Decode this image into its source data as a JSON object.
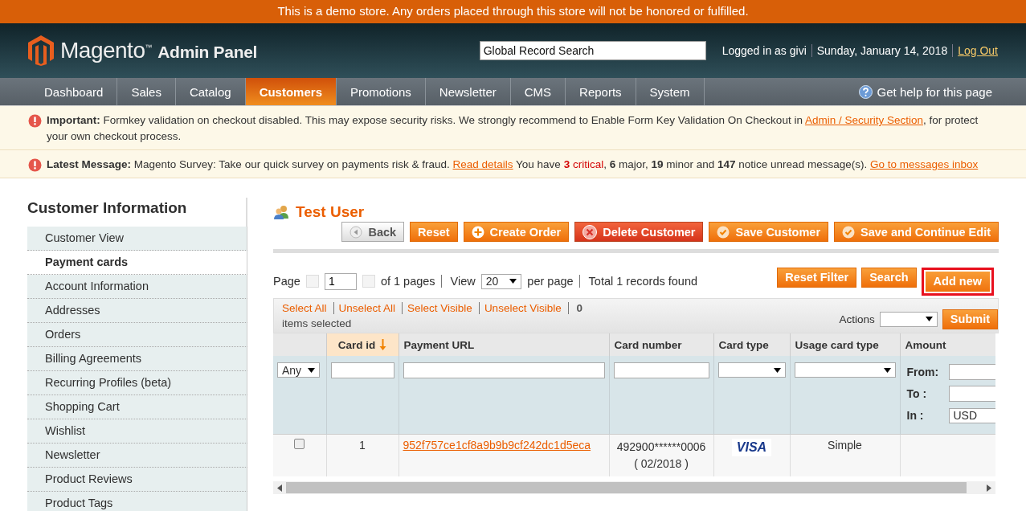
{
  "demo_notice": "This is a demo store. Any orders placed through this store will not be honored or fulfilled.",
  "header": {
    "logo": {
      "name": "Magento",
      "mark": "™",
      "suffix": "Admin Panel"
    },
    "search": {
      "placeholder": "Global Record Search"
    },
    "user": "Logged in as givi",
    "date": "Sunday, January 14, 2018",
    "logout": "Log Out"
  },
  "nav": {
    "tabs": [
      {
        "label": "Dashboard",
        "selected": false
      },
      {
        "label": "Sales",
        "selected": false
      },
      {
        "label": "Catalog",
        "selected": false
      },
      {
        "label": "Customers",
        "selected": true
      },
      {
        "label": "Promotions",
        "selected": false
      },
      {
        "label": "Newsletter",
        "selected": false
      },
      {
        "label": "CMS",
        "selected": false
      },
      {
        "label": "Reports",
        "selected": false
      },
      {
        "label": "System",
        "selected": false
      }
    ],
    "help": "Get help for this page"
  },
  "messages": [
    {
      "parts": [
        {
          "kind": "label",
          "text": "Important:"
        },
        {
          "kind": "text",
          "text": " Formkey validation on checkout disabled. This may expose security risks. We strongly recommend to Enable Form Key Validation On Checkout in "
        },
        {
          "kind": "link",
          "text": "Admin / Security Section"
        },
        {
          "kind": "text",
          "text": ", for protect your own checkout process."
        }
      ]
    },
    {
      "parts": [
        {
          "kind": "label",
          "text": "Latest Message:"
        },
        {
          "kind": "text",
          "text": " Magento Survey: Take our quick survey on payments risk & fraud. "
        },
        {
          "kind": "link",
          "text": "Read details"
        },
        {
          "kind": "text",
          "text": " You have "
        },
        {
          "kind": "critical",
          "text": "**3** critical"
        },
        {
          "kind": "text",
          "text": ", **6** major, **19** minor and **147** notice unread message(s). "
        },
        {
          "kind": "link",
          "text": "Go to messages inbox"
        }
      ]
    }
  ],
  "sidebar": {
    "title": "Customer Information",
    "items": [
      {
        "label": "Customer View",
        "selected": false
      },
      {
        "label": "Payment cards",
        "selected": true
      },
      {
        "label": "Account Information",
        "selected": false
      },
      {
        "label": "Addresses",
        "selected": false
      },
      {
        "label": "Orders",
        "selected": false
      },
      {
        "label": "Billing Agreements",
        "selected": false
      },
      {
        "label": "Recurring Profiles (beta)",
        "selected": false
      },
      {
        "label": "Shopping Cart",
        "selected": false
      },
      {
        "label": "Wishlist",
        "selected": false
      },
      {
        "label": "Newsletter",
        "selected": false
      },
      {
        "label": "Product Reviews",
        "selected": false
      },
      {
        "label": "Product Tags",
        "selected": false
      }
    ]
  },
  "page_title": "Test User",
  "buttons": [
    {
      "label": "Back",
      "kind": "back"
    },
    {
      "label": "Reset",
      "kind": "plain"
    },
    {
      "label": "Create Order",
      "kind": "add"
    },
    {
      "label": "Delete Customer",
      "kind": "delete"
    },
    {
      "label": "Save Customer",
      "kind": "save"
    },
    {
      "label": "Save and Continue Edit",
      "kind": "save"
    }
  ],
  "pager": {
    "page_label": "Page",
    "page": "1",
    "of_pages": "of 1 pages",
    "view_label": "View",
    "per_page": "20",
    "per_page_label": "per page",
    "total": "Total 1 records found"
  },
  "grid_buttons": [
    {
      "label": "Reset Filter",
      "highlighted": false
    },
    {
      "label": "Search",
      "highlighted": false
    },
    {
      "label": "Add new",
      "highlighted": true
    }
  ],
  "massaction": {
    "links": [
      "Select All",
      "Unselect All",
      "Select Visible",
      "Unselect Visible"
    ],
    "count": "0",
    "selected_label": "items selected",
    "actions_label": "Actions",
    "submit": "Submit"
  },
  "table": {
    "columns": [
      {
        "sorted": false
      },
      {
        "label": "Card id",
        "sorted": true
      },
      {
        "label": "Payment URL",
        "sorted": false
      },
      {
        "label": "Card number",
        "sorted": false
      },
      {
        "label": "Card type",
        "sorted": false
      },
      {
        "label": "Usage card type",
        "sorted": false
      },
      {
        "label": "Amount",
        "sorted": false
      }
    ],
    "filters": {
      "any": "Any",
      "from": "From:",
      "to": "To :",
      "in": "In :",
      "currency": "USD"
    },
    "rows": [
      {
        "checked": false,
        "id": "1",
        "url": "952f757ce1cf8a9b9b9cf242dc1d5eca",
        "card_number": "492900******0006",
        "expiry": "( 02/2018 )",
        "card_type": "VISA",
        "usage": "Simple"
      }
    ]
  }
}
